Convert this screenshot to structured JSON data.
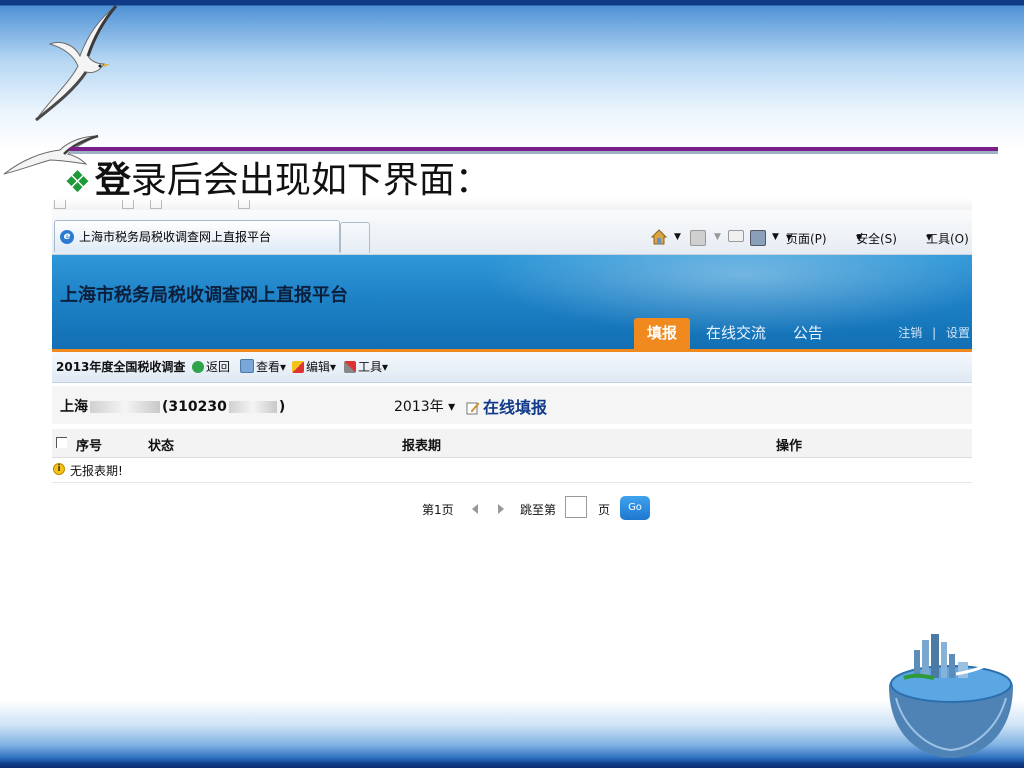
{
  "slide": {
    "title_first": "登",
    "title_rest": "录后会出现如下界面："
  },
  "browser": {
    "tab_title": "上海市税务局税收调查网上直报平台",
    "commands": {
      "page": "页面(P)",
      "safety": "安全(S)",
      "tools": "工具(O)"
    }
  },
  "site": {
    "title": "上海市税务局税收调查网上直报平台",
    "nav": [
      {
        "label": "填报",
        "active": true
      },
      {
        "label": "在线交流",
        "active": false
      },
      {
        "label": "公告",
        "active": false
      }
    ],
    "links": {
      "logout": "注销",
      "separator": "|",
      "settings": "设置"
    }
  },
  "toolbar": {
    "title": "2013年度全国税收调查",
    "back": "返回",
    "view": "查看",
    "edit": "编辑",
    "tools": "工具"
  },
  "company": {
    "name_start": "上海",
    "name_end": "(310230",
    "name_tail": ")",
    "year": "2013年",
    "online_fill": "在线填报"
  },
  "table": {
    "headers": [
      "序号",
      "状态",
      "报表期",
      "操作"
    ],
    "empty_message": "无报表期!"
  },
  "pager": {
    "current": "第1页",
    "goto_prefix": "跳至第",
    "goto_suffix": "页",
    "go": "Go"
  },
  "colors": {
    "accent_orange": "#f08a1e",
    "banner_blue": "#1c7fc4",
    "slide_purple": "#7a1f8a",
    "bullet_green": "#1e9a36"
  }
}
